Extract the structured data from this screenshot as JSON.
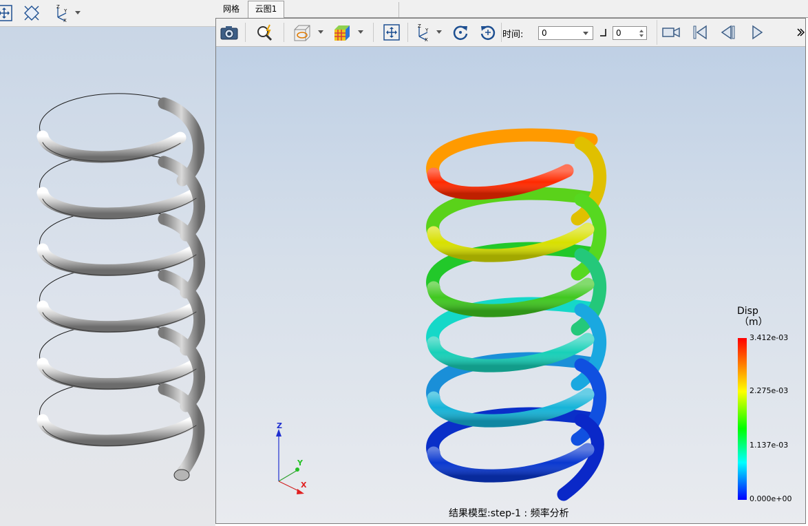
{
  "tabs": [
    {
      "label": "网格"
    },
    {
      "label": "云图1"
    }
  ],
  "toolbar": {
    "time_label": "时间:",
    "time_value": "0",
    "frame_value": "0"
  },
  "icons": {
    "left_toolbar": [
      "fit-view-icon",
      "iso-view-icon",
      "axis-triad-icon",
      "chevron-down-icon"
    ],
    "main_toolbar": [
      "camera-icon",
      "query-icon",
      "section-box-icon",
      "chevron-down-icon",
      "contour-cube-icon",
      "chevron-down-icon",
      "fit-view-icon",
      "axis-triad-icon",
      "chevron-down-icon",
      "rotate-cw-icon",
      "rotate-ccw-icon",
      "step-icon",
      "video-record-icon",
      "skip-first-icon",
      "step-back-icon",
      "play-icon",
      "overflow-icon"
    ]
  },
  "legend": {
    "title": "Disp",
    "unit": "（m）",
    "ticks": [
      "3.412e-03",
      "2.275e-03",
      "1.137e-03",
      "0.000e+00"
    ],
    "colors": [
      "#ff0000",
      "#ffff00",
      "#00ff00",
      "#00ffff",
      "#0000ff"
    ]
  },
  "triad": {
    "x": "X",
    "y": "Y",
    "z": "Z"
  },
  "caption": "结果模型:step-1 : 频率分析",
  "colors": {
    "spring_mesh": "#a9a9a9",
    "viewport_top": "#bfd0e5",
    "viewport_bottom": "#e9ebef"
  }
}
